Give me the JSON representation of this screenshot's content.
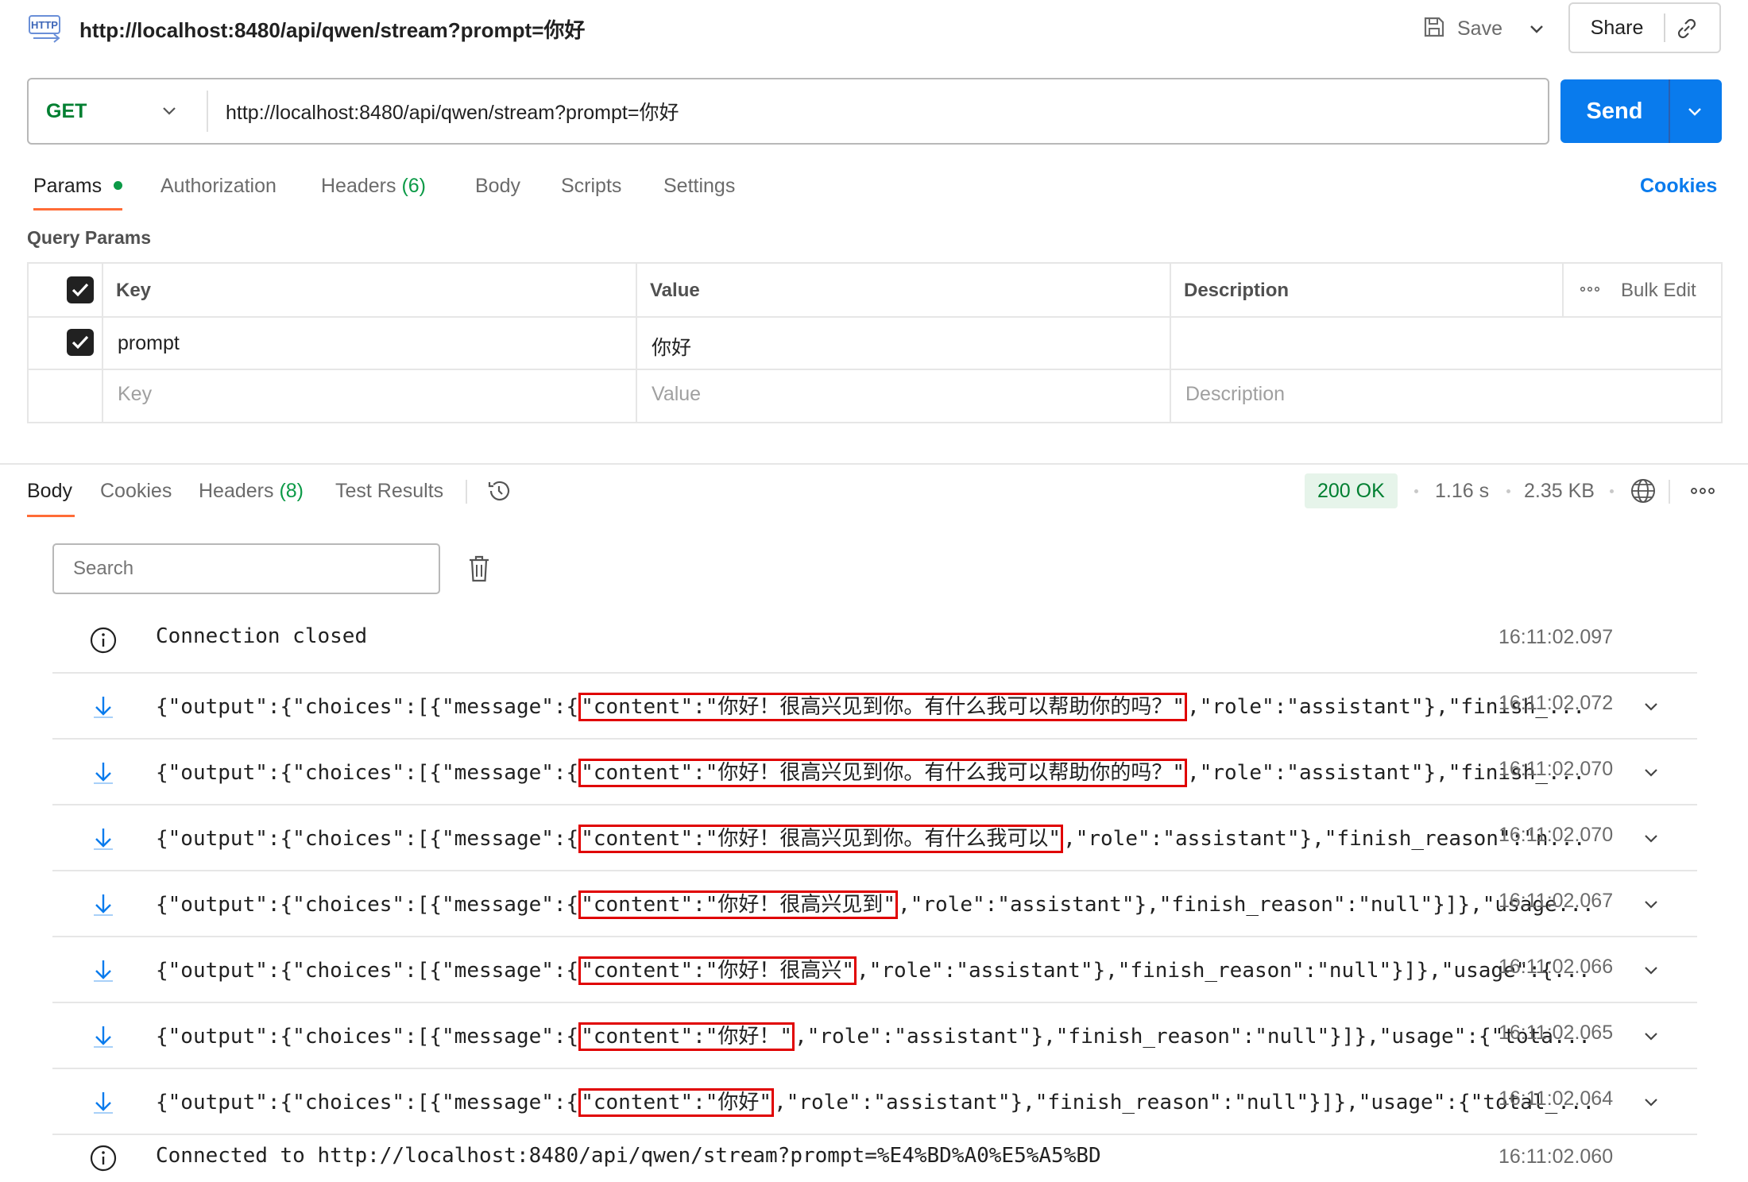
{
  "request": {
    "title": "http://localhost:8480/api/qwen/stream?prompt=你好",
    "http_badge": "HTTP",
    "save_label": "Save",
    "share_label": "Share",
    "method": "GET",
    "url": "http://localhost:8480/api/qwen/stream?prompt=你好",
    "send_label": "Send"
  },
  "request_tabs": {
    "params": "Params",
    "authorization": "Authorization",
    "headers": "Headers",
    "headers_count": "(6)",
    "body": "Body",
    "scripts": "Scripts",
    "settings": "Settings",
    "cookies": "Cookies"
  },
  "query_params": {
    "title": "Query Params",
    "columns": {
      "key": "Key",
      "value": "Value",
      "description": "Description"
    },
    "bulk_edit": "Bulk Edit",
    "rows": [
      {
        "key": "prompt",
        "value": "你好",
        "description": ""
      }
    ],
    "placeholder": {
      "key": "Key",
      "value": "Value",
      "description": "Description"
    }
  },
  "response_tabs": {
    "body": "Body",
    "cookies": "Cookies",
    "headers": "Headers",
    "headers_count": "(8)",
    "test_results": "Test Results"
  },
  "response_meta": {
    "status": "200 OK",
    "time": "1.16 s",
    "size": "2.35 KB"
  },
  "search": {
    "placeholder": "Search"
  },
  "events": [
    {
      "type": "info",
      "pre": "Connection closed",
      "hl": "",
      "post": "",
      "time": "16:11:02.097"
    },
    {
      "type": "message",
      "pre": "{\"output\":{\"choices\":[{\"message\":{",
      "hl": "\"content\":\"你好！很高兴见到你。有什么我可以帮助你的吗？\"",
      "post": ",\"role\":\"assistant\"},\"finish_...",
      "time": "16:11:02.072"
    },
    {
      "type": "message",
      "pre": "{\"output\":{\"choices\":[{\"message\":{",
      "hl": "\"content\":\"你好！很高兴见到你。有什么我可以帮助你的吗？\"",
      "post": ",\"role\":\"assistant\"},\"finish_...",
      "time": "16:11:02.070"
    },
    {
      "type": "message",
      "pre": "{\"output\":{\"choices\":[{\"message\":{",
      "hl": "\"content\":\"你好！很高兴见到你。有什么我可以\"",
      "post": ",\"role\":\"assistant\"},\"finish_reason\":\"n...",
      "time": "16:11:02.070"
    },
    {
      "type": "message",
      "pre": "{\"output\":{\"choices\":[{\"message\":{",
      "hl": "\"content\":\"你好！很高兴见到\"",
      "post": ",\"role\":\"assistant\"},\"finish_reason\":\"null\"}]},\"usage...",
      "time": "16:11:02.067"
    },
    {
      "type": "message",
      "pre": "{\"output\":{\"choices\":[{\"message\":{",
      "hl": "\"content\":\"你好！很高兴\"",
      "post": ",\"role\":\"assistant\"},\"finish_reason\":\"null\"}]},\"usage\":{...",
      "time": "16:11:02.066"
    },
    {
      "type": "message",
      "pre": "{\"output\":{\"choices\":[{\"message\":{",
      "hl": "\"content\":\"你好！\"",
      "post": ",\"role\":\"assistant\"},\"finish_reason\":\"null\"}]},\"usage\":{\"tota...",
      "time": "16:11:02.065"
    },
    {
      "type": "message",
      "pre": "{\"output\":{\"choices\":[{\"message\":{",
      "hl": "\"content\":\"你好\"",
      "post": ",\"role\":\"assistant\"},\"finish_reason\":\"null\"}]},\"usage\":{\"total_...",
      "time": "16:11:02.064"
    },
    {
      "type": "info",
      "pre": "Connected to http://localhost:8480/api/qwen/stream?prompt=%E4%BD%A0%E5%A5%BD",
      "hl": "",
      "post": "",
      "time": "16:11:02.060"
    }
  ],
  "colors": {
    "accent": "#097bed",
    "get": "#007f31",
    "status_bg": "#e6f4ea",
    "highlight": "#e00000"
  }
}
